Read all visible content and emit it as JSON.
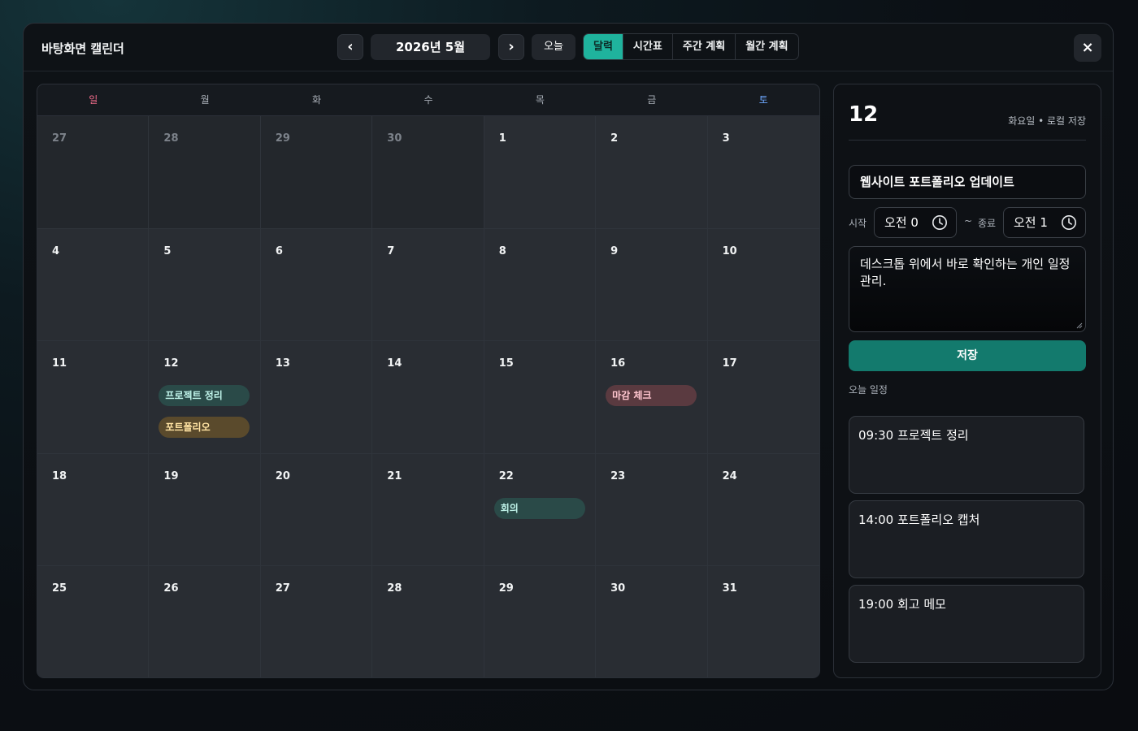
{
  "app": {
    "title": "바탕화면 캘린더"
  },
  "header": {
    "prev_label": "‹",
    "next_label": "›",
    "month_label": "2026년 5월",
    "today_label": "오늘",
    "view_tabs": [
      {
        "label": "달력",
        "active": true
      },
      {
        "label": "시간표",
        "active": false
      },
      {
        "label": "주간 계획",
        "active": false
      },
      {
        "label": "월간 계획",
        "active": false
      }
    ],
    "close_label": "×"
  },
  "calendar": {
    "weekdays": [
      "일",
      "월",
      "화",
      "수",
      "목",
      "금",
      "토"
    ],
    "days": [
      {
        "label": "27",
        "muted": true
      },
      {
        "label": "28",
        "muted": true
      },
      {
        "label": "29",
        "muted": true
      },
      {
        "label": "30",
        "muted": true
      },
      {
        "label": "1"
      },
      {
        "label": "2"
      },
      {
        "label": "3"
      },
      {
        "label": "4"
      },
      {
        "label": "5"
      },
      {
        "label": "6"
      },
      {
        "label": "7"
      },
      {
        "label": "8"
      },
      {
        "label": "9"
      },
      {
        "label": "10"
      },
      {
        "label": "11"
      },
      {
        "label": "12",
        "events": [
          {
            "label": "프로젝트 정리",
            "color": "teal"
          },
          {
            "label": "포트폴리오",
            "color": "gold"
          }
        ]
      },
      {
        "label": "13"
      },
      {
        "label": "14"
      },
      {
        "label": "15"
      },
      {
        "label": "16",
        "events": [
          {
            "label": "마감 체크",
            "color": "red"
          }
        ]
      },
      {
        "label": "17"
      },
      {
        "label": "18"
      },
      {
        "label": "19"
      },
      {
        "label": "20"
      },
      {
        "label": "21"
      },
      {
        "label": "22",
        "events": [
          {
            "label": "회의",
            "color": "teal"
          }
        ]
      },
      {
        "label": "23"
      },
      {
        "label": "24"
      },
      {
        "label": "25"
      },
      {
        "label": "26"
      },
      {
        "label": "27"
      },
      {
        "label": "28"
      },
      {
        "label": "29"
      },
      {
        "label": "30"
      },
      {
        "label": "31"
      }
    ]
  },
  "detail": {
    "day": "12",
    "meta": "화요일 • 로컬 저장",
    "title_value": "웹사이트 포트폴리오 업데이트",
    "start_label": "시작",
    "start_value": "오전 0",
    "separator": "~",
    "end_label": "종료",
    "end_value": "오전 1",
    "note_value": "데스크톱 위에서 바로 확인하는 개인 일정 관리.",
    "save_label": "저장",
    "agenda_label": "오늘 일정",
    "agenda": [
      "09:30 프로젝트 정리",
      "14:00 포트폴리오 캡처",
      "19:00 회고 메모"
    ]
  },
  "colors": {
    "accent": "#1fb39d",
    "save": "#137a6d",
    "sunday": "#f06b8a",
    "saturday": "#6ea8ff"
  }
}
